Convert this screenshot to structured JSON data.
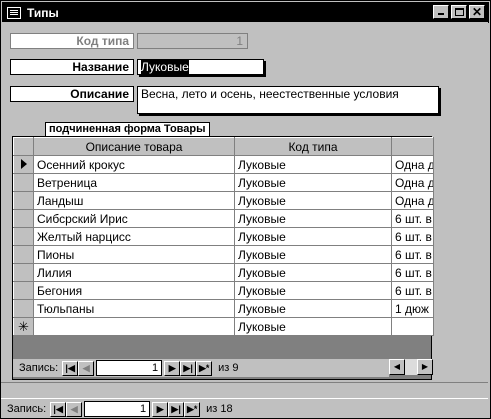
{
  "window": {
    "title": "Типы"
  },
  "form": {
    "code_label": "Код типа",
    "code_value": "1",
    "name_label": "Название",
    "name_value": "Луковые",
    "desc_label": "Описание",
    "desc_value": "Весна, лето и осень, неестественные условия"
  },
  "subform": {
    "title": "подчиненная форма Товары",
    "columns": [
      "Описание товара",
      "Код типа",
      ""
    ],
    "rows": [
      [
        "Осенний крокус",
        "Луковые",
        "Одна д"
      ],
      [
        "Ветреница",
        "Луковые",
        "Одна д"
      ],
      [
        "Ландыш",
        "Луковые",
        "Одна д"
      ],
      [
        "Сибсрский Ирис",
        "Луковые",
        "6 шт. в"
      ],
      [
        "Желтый нарцисс",
        "Луковые",
        "6 шт. в"
      ],
      [
        "Пионы",
        "Луковые",
        "6 шт. в"
      ],
      [
        "Лилия",
        "Луковые",
        "6 шт. в"
      ],
      [
        "Бегония",
        "Луковые",
        "6 шт. в"
      ],
      [
        "Тюльпаны",
        "Луковые",
        "1 дюж"
      ]
    ],
    "new_row": [
      "",
      "Луковые",
      ""
    ],
    "nav": {
      "label": "Запись:",
      "current": "1",
      "of": "из  9"
    }
  },
  "main_nav": {
    "label": "Запись:",
    "current": "1",
    "of": "из  18"
  }
}
